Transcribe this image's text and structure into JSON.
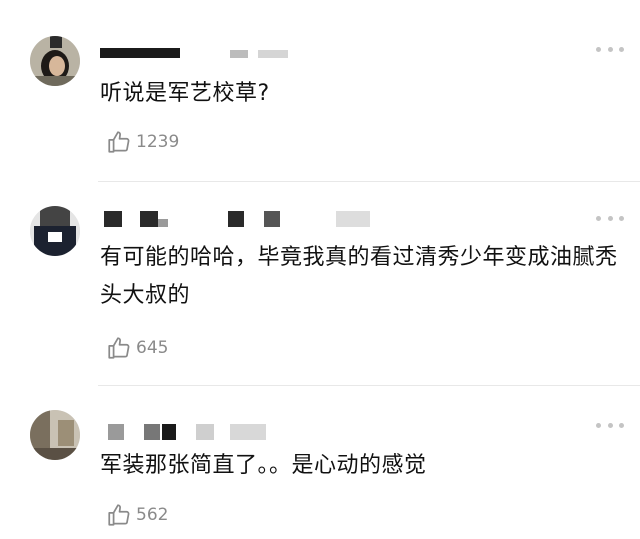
{
  "colors": {
    "background": "#ffffff",
    "text": "#111111",
    "meta": "#8a8a8a",
    "divider": "#e8e8e8",
    "more_dots": "#c4c4c4"
  },
  "icons": {
    "like": "thumbs-up-icon",
    "more": "more-dots-icon"
  },
  "comments": [
    {
      "text": "听说是军艺校草?",
      "likes": "1239"
    },
    {
      "text": "有可能的哈哈，毕竟我真的看过清秀少年变成油腻秃头大叔的",
      "likes": "645"
    },
    {
      "text": "军装那张简直了。。是心动的感觉",
      "likes": "562"
    }
  ]
}
